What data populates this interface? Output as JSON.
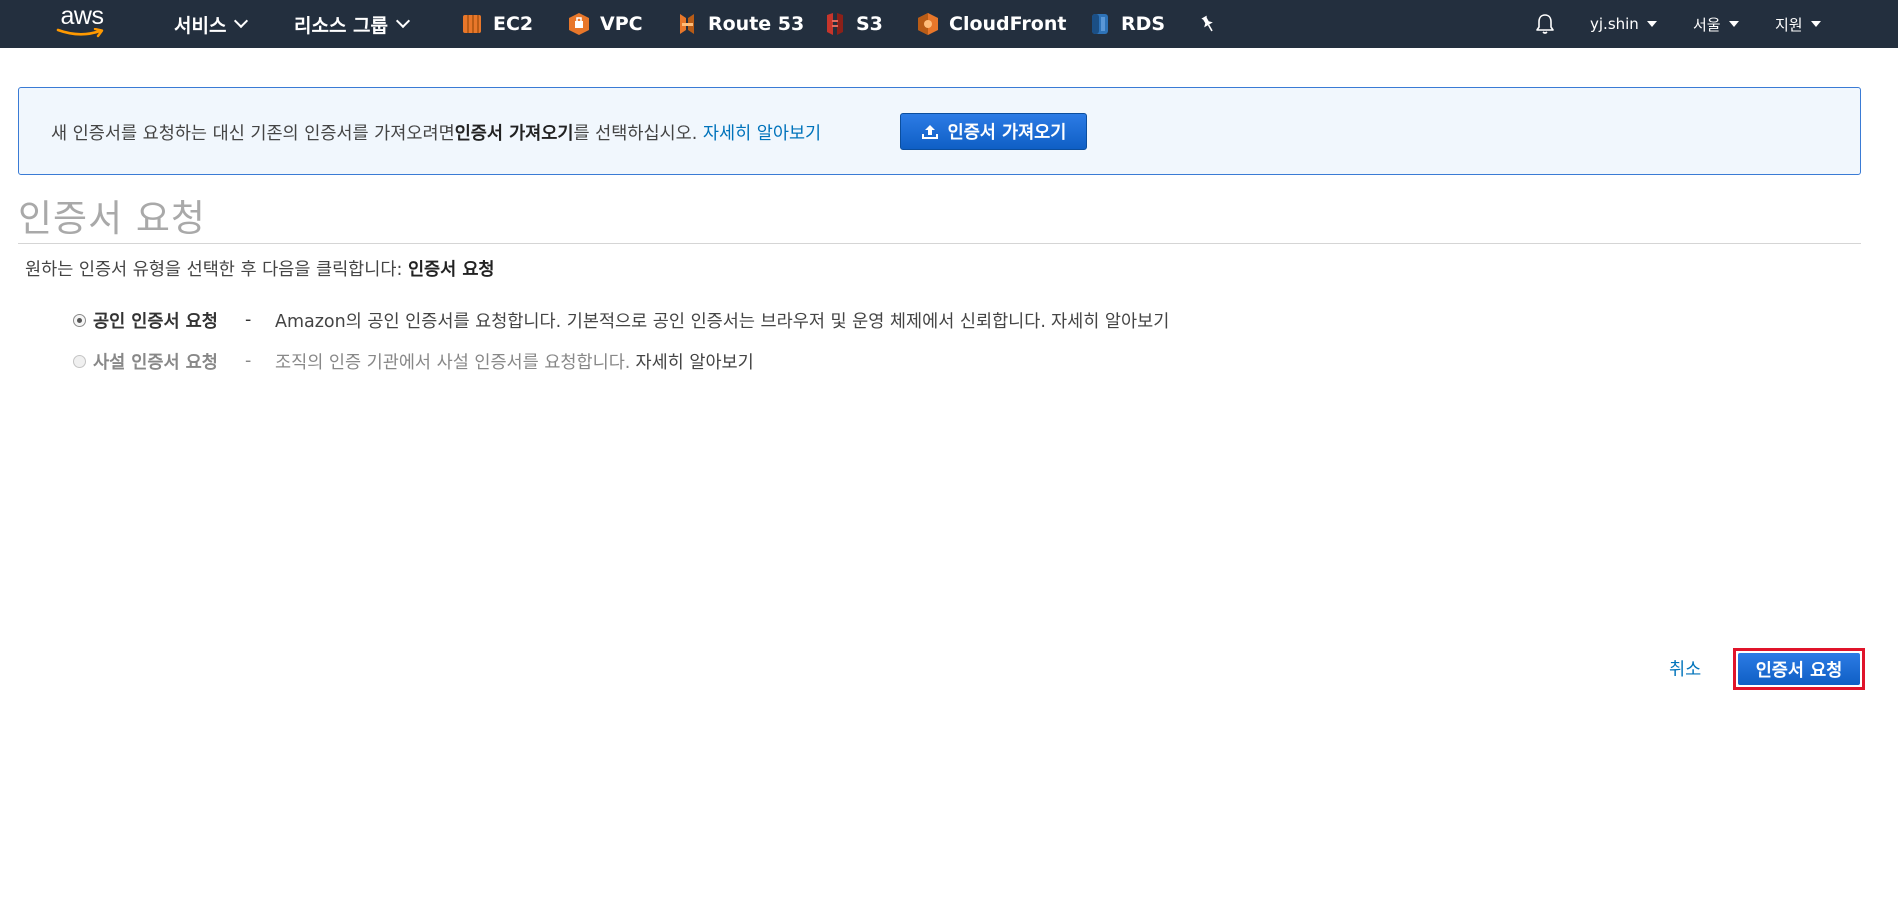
{
  "nav": {
    "logo_text": "aws",
    "services_label": "서비스",
    "resource_groups_label": "리소스 그룹",
    "shortcuts": [
      {
        "label": "EC2",
        "icon": "ec2-icon",
        "color": "#e8772a"
      },
      {
        "label": "VPC",
        "icon": "vpc-icon",
        "color": "#e8772a"
      },
      {
        "label": "Route 53",
        "icon": "route53-icon",
        "color": "#e8772a"
      },
      {
        "label": "S3",
        "icon": "s3-icon",
        "color": "#c7352b"
      },
      {
        "label": "CloudFront",
        "icon": "cloudfront-icon",
        "color": "#e8772a"
      },
      {
        "label": "RDS",
        "icon": "rds-icon",
        "color": "#2e73b8"
      }
    ],
    "pin_icon": "pin-icon",
    "bell_icon": "bell-icon",
    "user_label": "yj.shin",
    "region_label": "서울",
    "support_label": "지원"
  },
  "info": {
    "text_before": "새 인증서를 요청하는 대신 기존의 인증서를 가져오려면 ",
    "text_bold": "인증서 가져오기",
    "text_after": "를 선택하십시오. ",
    "learn_more": "자세히 알아보기",
    "import_button": "인증서 가져오기",
    "upload_icon": "upload-icon"
  },
  "page": {
    "title": "인증서 요청",
    "instruction_prefix": "원하는 인증서 유형을 선택한 후 다음을 클릭합니다: ",
    "instruction_bold": "인증서 요청"
  },
  "options": {
    "public": {
      "label": "공인 인증서 요청",
      "dash": "-",
      "description": "Amazon의 공인 인증서를 요청합니다. 기본적으로 공인 인증서는 브라우저 및 운영 체제에서 신뢰합니다. ",
      "learn_more": "자세히 알아보기",
      "selected": true
    },
    "private": {
      "label": "사설 인증서 요청",
      "dash": "-",
      "description": "조직의 인증 기관에서 사설 인증서를 요청합니다. ",
      "learn_more": "자세히 알아보기",
      "selected": false,
      "disabled": true
    }
  },
  "footer": {
    "cancel_label": "취소",
    "request_label": "인증서 요청"
  },
  "colors": {
    "nav_bg": "#232f3e",
    "link": "#0073bb",
    "primary_button": "#1166cc",
    "highlight_border": "#e0142a",
    "info_bg": "#f1f7fd"
  }
}
